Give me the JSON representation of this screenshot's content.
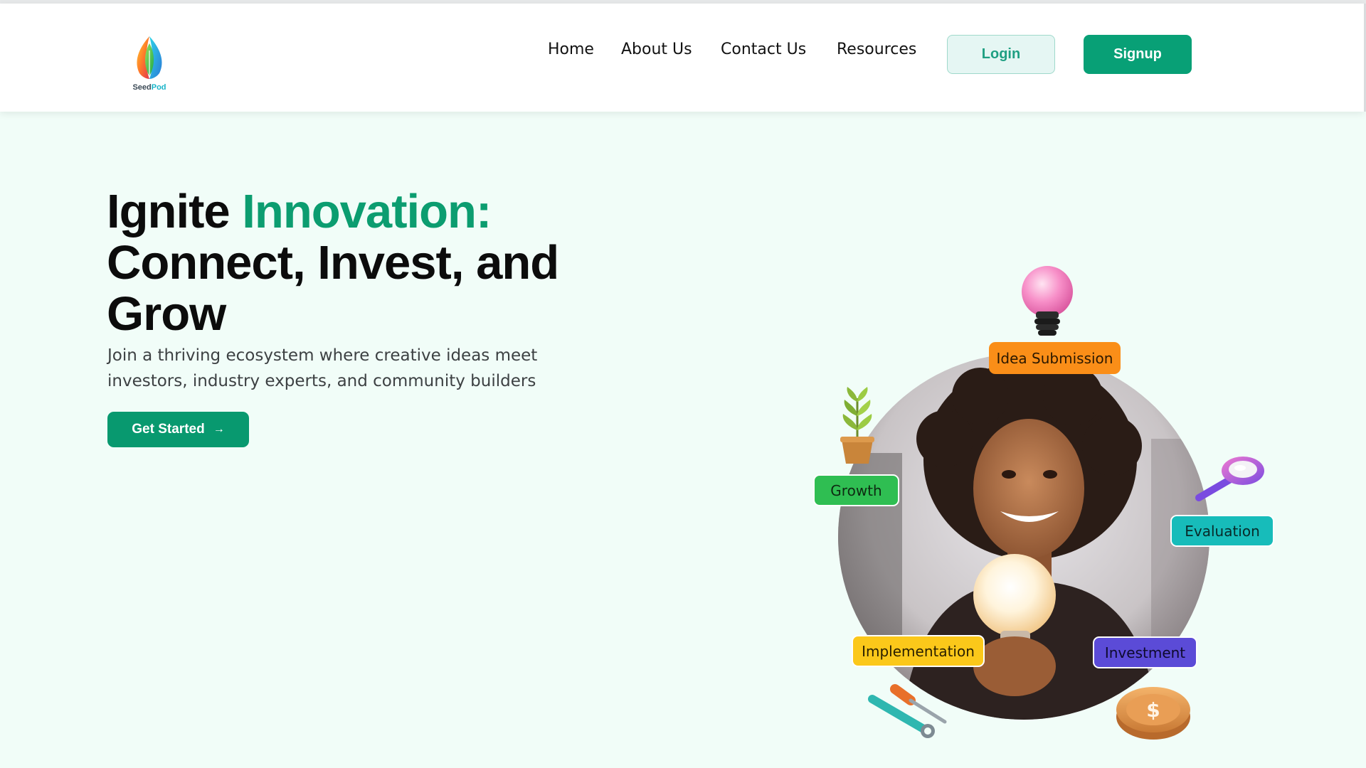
{
  "brand": {
    "name_part1": "Seed",
    "name_part2": "Pod"
  },
  "nav": {
    "items": [
      "Home",
      "About Us",
      "Contact Us",
      "Resources"
    ],
    "login_label": "Login",
    "signup_label": "Signup"
  },
  "hero": {
    "title_word1": "Ignite",
    "title_accent": "Innovation:",
    "title_line2": "Connect, Invest, and",
    "title_line3": "Grow",
    "subtitle": "Join a thriving ecosystem where creative ideas meet investors, industry experts, and community builders",
    "cta_label": "Get Started",
    "cta_arrow": "→"
  },
  "stages": {
    "idea": "Idea Submission",
    "growth": "Growth",
    "evaluation": "Evaluation",
    "implementation": "Implementation",
    "investment": "Investment"
  },
  "icons": {
    "bulb": "lightbulb-icon",
    "plant": "plant-icon",
    "magnifier": "magnifying-glass-icon",
    "tools": "tools-icon",
    "coin": "dollar-coin-icon"
  },
  "colors": {
    "brand_green": "#08a076",
    "accent_text": "#0c9d70",
    "hero_bg": "#f1fdf8",
    "idea": "#fa8e18",
    "growth": "#2fbe52",
    "evaluation": "#17bcba",
    "implementation": "#fbc81a",
    "investment": "#5b4bd7"
  }
}
